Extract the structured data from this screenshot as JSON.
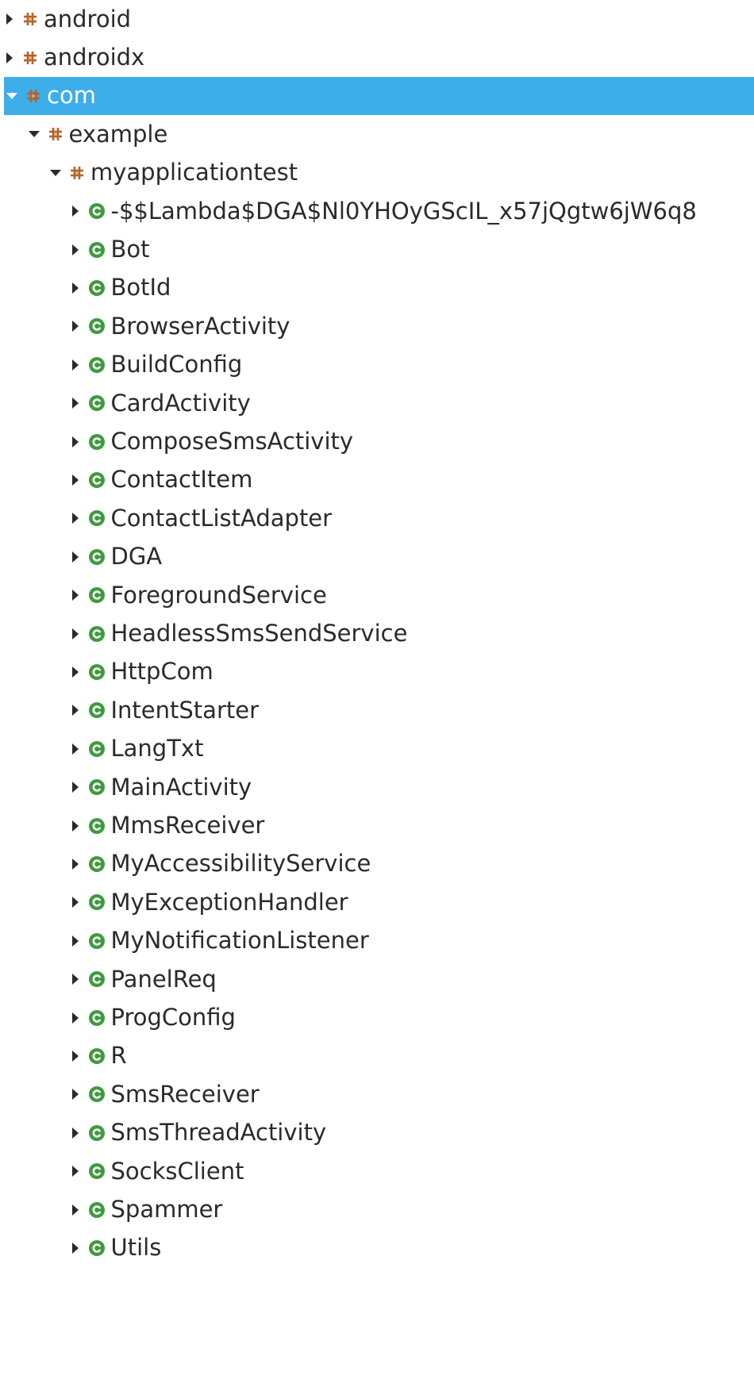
{
  "colors": {
    "selection": "#3daee9",
    "package_icon": "#b5632a",
    "class_icon": "#3f9a3f",
    "text": "#2a2a2a"
  },
  "icons": {
    "package": "package-icon",
    "class": "class-icon",
    "expanded": "chevron-down-icon",
    "collapsed": "chevron-right-icon"
  },
  "tree": [
    {
      "label": "android",
      "kind": "package",
      "depth": 0,
      "expanded": false,
      "selected": false
    },
    {
      "label": "androidx",
      "kind": "package",
      "depth": 0,
      "expanded": false,
      "selected": false
    },
    {
      "label": "com",
      "kind": "package",
      "depth": 0,
      "expanded": true,
      "selected": true
    },
    {
      "label": "example",
      "kind": "package",
      "depth": 1,
      "expanded": true,
      "selected": false
    },
    {
      "label": "myapplicationtest",
      "kind": "package",
      "depth": 2,
      "expanded": true,
      "selected": false
    },
    {
      "label": "-$$Lambda$DGA$Nl0YHOyGScIL_x57jQgtw6jW6q8",
      "kind": "class",
      "depth": 3,
      "expanded": false,
      "selected": false
    },
    {
      "label": "Bot",
      "kind": "class",
      "depth": 3,
      "expanded": false,
      "selected": false
    },
    {
      "label": "BotId",
      "kind": "class",
      "depth": 3,
      "expanded": false,
      "selected": false
    },
    {
      "label": "BrowserActivity",
      "kind": "class",
      "depth": 3,
      "expanded": false,
      "selected": false
    },
    {
      "label": "BuildConfig",
      "kind": "class",
      "depth": 3,
      "expanded": false,
      "selected": false
    },
    {
      "label": "CardActivity",
      "kind": "class",
      "depth": 3,
      "expanded": false,
      "selected": false
    },
    {
      "label": "ComposeSmsActivity",
      "kind": "class",
      "depth": 3,
      "expanded": false,
      "selected": false
    },
    {
      "label": "ContactItem",
      "kind": "class",
      "depth": 3,
      "expanded": false,
      "selected": false
    },
    {
      "label": "ContactListAdapter",
      "kind": "class",
      "depth": 3,
      "expanded": false,
      "selected": false
    },
    {
      "label": "DGA",
      "kind": "class",
      "depth": 3,
      "expanded": false,
      "selected": false
    },
    {
      "label": "ForegroundService",
      "kind": "class",
      "depth": 3,
      "expanded": false,
      "selected": false
    },
    {
      "label": "HeadlessSmsSendService",
      "kind": "class",
      "depth": 3,
      "expanded": false,
      "selected": false
    },
    {
      "label": "HttpCom",
      "kind": "class",
      "depth": 3,
      "expanded": false,
      "selected": false
    },
    {
      "label": "IntentStarter",
      "kind": "class",
      "depth": 3,
      "expanded": false,
      "selected": false
    },
    {
      "label": "LangTxt",
      "kind": "class",
      "depth": 3,
      "expanded": false,
      "selected": false
    },
    {
      "label": "MainActivity",
      "kind": "class",
      "depth": 3,
      "expanded": false,
      "selected": false
    },
    {
      "label": "MmsReceiver",
      "kind": "class",
      "depth": 3,
      "expanded": false,
      "selected": false
    },
    {
      "label": "MyAccessibilityService",
      "kind": "class",
      "depth": 3,
      "expanded": false,
      "selected": false
    },
    {
      "label": "MyExceptionHandler",
      "kind": "class",
      "depth": 3,
      "expanded": false,
      "selected": false
    },
    {
      "label": "MyNotificationListener",
      "kind": "class",
      "depth": 3,
      "expanded": false,
      "selected": false
    },
    {
      "label": "PanelReq",
      "kind": "class",
      "depth": 3,
      "expanded": false,
      "selected": false
    },
    {
      "label": "ProgConfig",
      "kind": "class",
      "depth": 3,
      "expanded": false,
      "selected": false
    },
    {
      "label": "R",
      "kind": "class",
      "depth": 3,
      "expanded": false,
      "selected": false
    },
    {
      "label": "SmsReceiver",
      "kind": "class",
      "depth": 3,
      "expanded": false,
      "selected": false
    },
    {
      "label": "SmsThreadActivity",
      "kind": "class",
      "depth": 3,
      "expanded": false,
      "selected": false
    },
    {
      "label": "SocksClient",
      "kind": "class",
      "depth": 3,
      "expanded": false,
      "selected": false
    },
    {
      "label": "Spammer",
      "kind": "class",
      "depth": 3,
      "expanded": false,
      "selected": false
    },
    {
      "label": "Utils",
      "kind": "class",
      "depth": 3,
      "expanded": false,
      "selected": false
    }
  ]
}
